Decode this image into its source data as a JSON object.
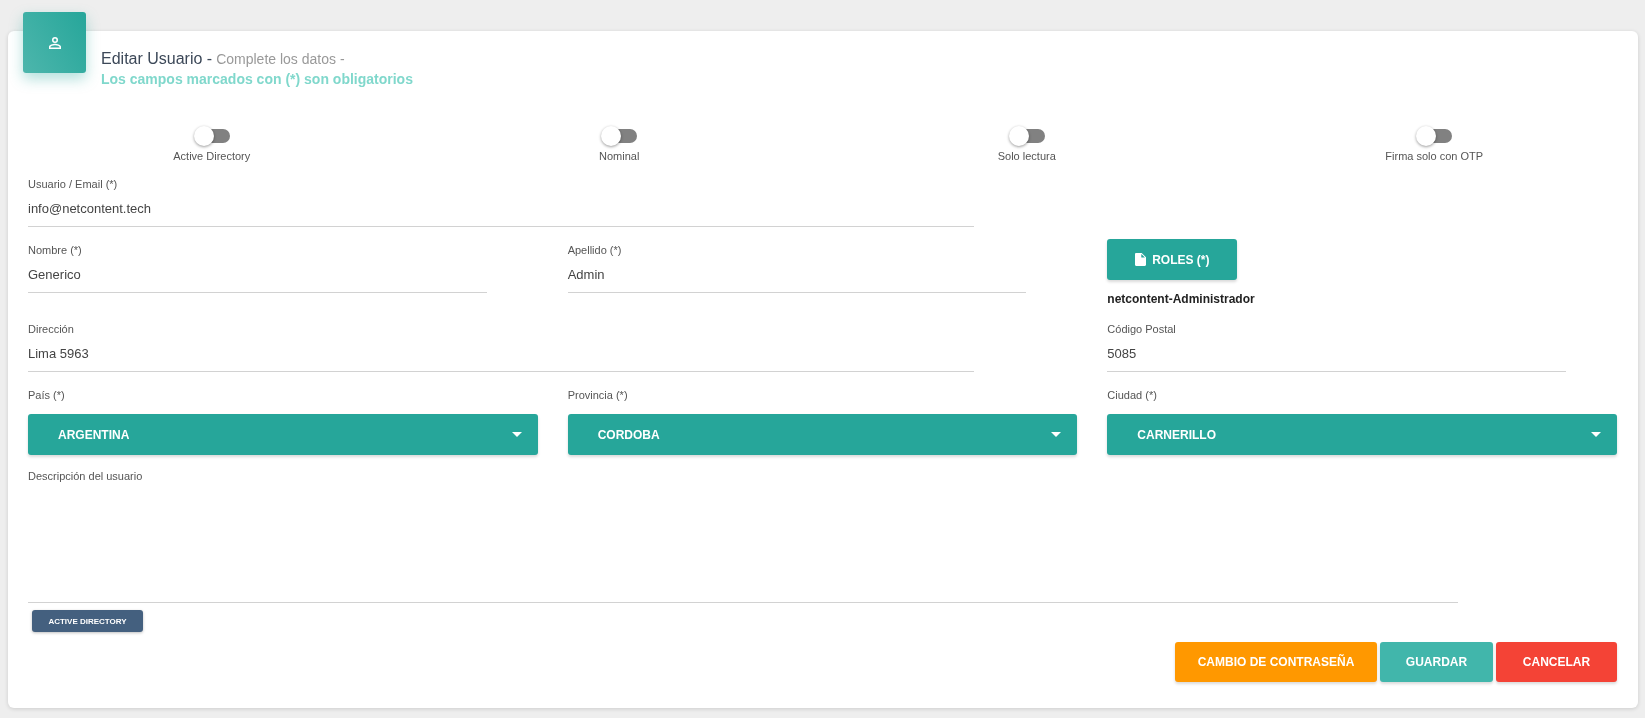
{
  "header": {
    "title": "Editar Usuario -",
    "subtitle": "Complete los datos -",
    "note": "Los campos marcados con (*) son obligatorios"
  },
  "toggles": [
    {
      "label": "Active Directory",
      "on": false
    },
    {
      "label": "Nominal",
      "on": false
    },
    {
      "label": "Solo lectura",
      "on": false
    },
    {
      "label": "Firma solo con OTP",
      "on": false
    }
  ],
  "form": {
    "usuario_email": {
      "label": "Usuario / Email (*)",
      "value": "info@netcontent.tech"
    },
    "nombre": {
      "label": "Nombre (*)",
      "value": "Generico"
    },
    "apellido": {
      "label": "Apellido (*)",
      "value": "Admin"
    },
    "roles": {
      "button": "ROLES (*)",
      "assigned": [
        "netcontent-Administrador"
      ]
    },
    "direccion": {
      "label": "Dirección",
      "value": "Lima 5963"
    },
    "codigo_postal": {
      "label": "Código Postal",
      "value": "5085"
    },
    "pais": {
      "label": "País (*)",
      "value": "ARGENTINA"
    },
    "provincia": {
      "label": "Provincia (*)",
      "value": "CORDOBA"
    },
    "ciudad": {
      "label": "Ciudad (*)",
      "value": "CARNERILLO"
    },
    "descripcion": {
      "label": "Descripción del usuario"
    }
  },
  "active_directory_button": "ACTIVE DIRECTORY",
  "actions": [
    {
      "label": "CAMBIO DE CONTRASEÑA",
      "kind": "warning"
    },
    {
      "label": "GUARDAR",
      "kind": "primary"
    },
    {
      "label": "CANCELAR",
      "kind": "danger"
    }
  ]
}
